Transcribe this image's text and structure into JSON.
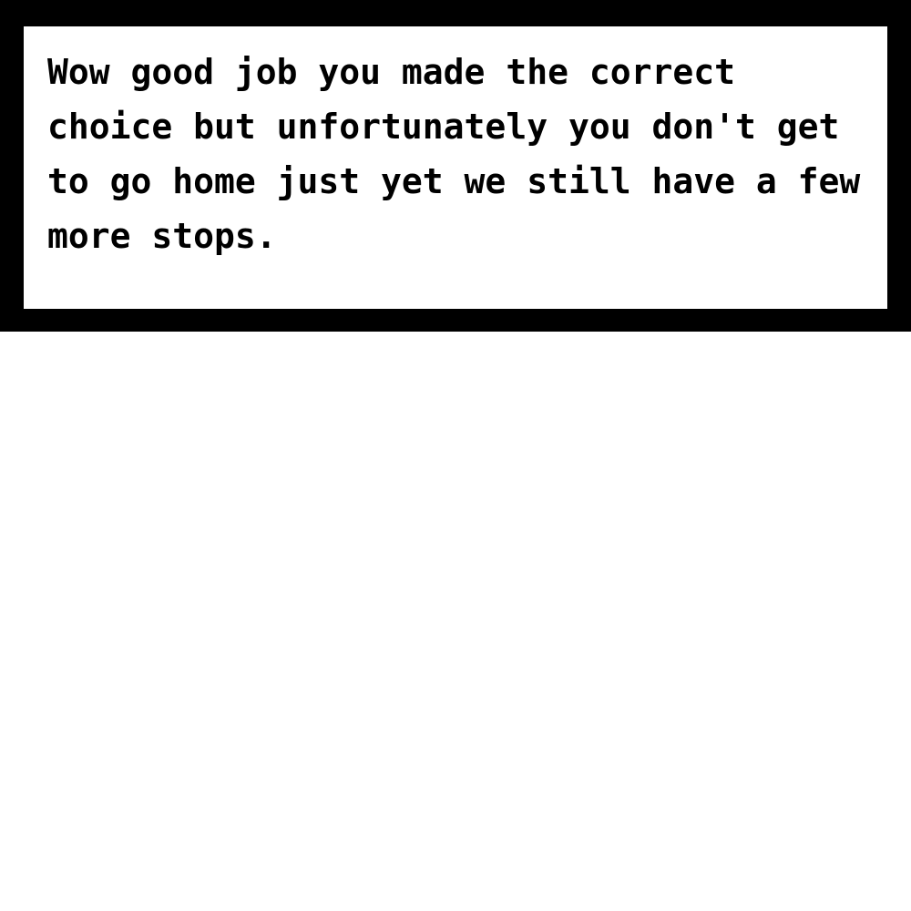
{
  "dialog": {
    "lines": [
      "Wow good job you made the correct",
      "choice but unfortunately you don't get",
      "to go home just yet we still have a few",
      "more stops."
    ]
  },
  "colors": {
    "frame": "#000000",
    "background": "#ffffff",
    "text": "#000000"
  }
}
